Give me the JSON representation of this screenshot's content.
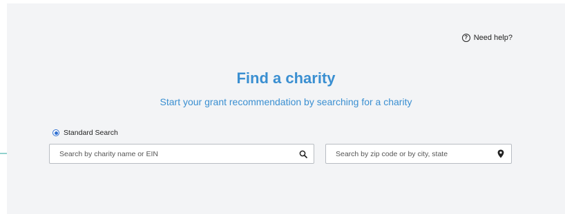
{
  "help": {
    "label": "Need help?",
    "icon": "question-circle-icon"
  },
  "heading": {
    "title": "Find a charity",
    "subtitle": "Start your grant recommendation by searching for a charity"
  },
  "search_mode": {
    "label": "Standard Search",
    "selected": true
  },
  "name_search": {
    "placeholder": "Search by charity name or EIN",
    "value": "",
    "icon": "search-icon"
  },
  "location_search": {
    "placeholder": "Search by zip code or by city, state",
    "value": "",
    "icon": "map-pin-icon"
  },
  "colors": {
    "accent": "#3a8fd1",
    "arrow": "#4fb8b0",
    "radio": "#2f6fd1",
    "panel": "#f3f4f6"
  }
}
